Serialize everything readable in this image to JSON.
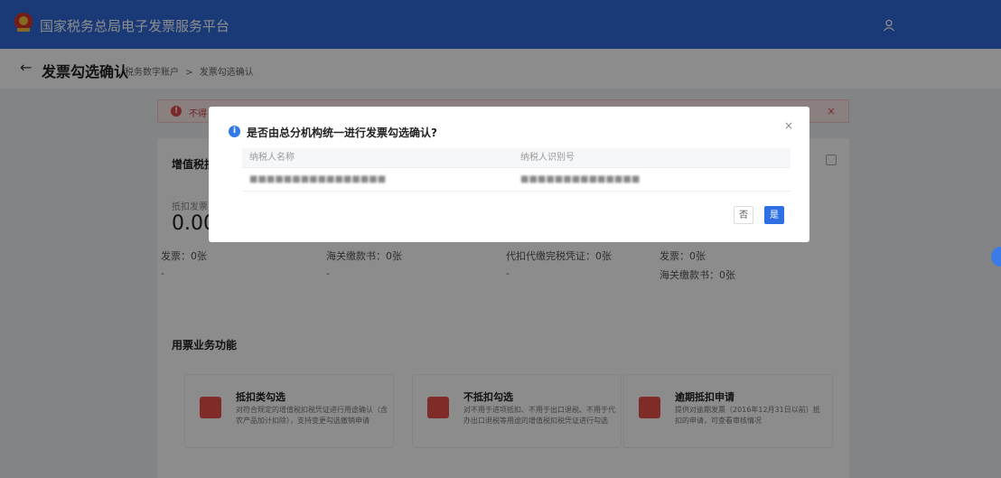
{
  "header": {
    "app_title": "国家税务总局电子发票服务平台"
  },
  "subheader": {
    "back_glyph": "←",
    "page_title": "发票勾选确认",
    "breadcrumb": [
      "税务数字账户",
      ">",
      "发票勾选确认"
    ]
  },
  "alert": {
    "text": "不得",
    "close": "×"
  },
  "stats": {
    "title": "增值税抵",
    "label": "抵扣发票",
    "big_value": "0.00",
    "cols": [
      {
        "line1": "发票：0张",
        "line2": "-"
      },
      {
        "line1": "海关缴款书：0张",
        "line2": "-"
      },
      {
        "line1": "代扣代缴完税凭证：0张",
        "line2": "-"
      },
      {
        "line1": "发票：0张",
        "line2": "海关缴款书：0张"
      }
    ]
  },
  "functions": {
    "title": "用票业务功能",
    "items": [
      {
        "title": "抵扣类勾选",
        "desc": "对符合规定的增值税扣税凭证进行用途确认（含农产品加计扣除），支持变更勾选撤销申请"
      },
      {
        "title": "不抵扣勾选",
        "desc": "对不用于进项抵扣、不用于出口退税、不用于代办出口退税等用途的增值税扣税凭证进行勾选"
      },
      {
        "title": "逾期抵扣申请",
        "desc": "提供对逾期发票（2016年12月31日以前）抵扣的申请，可查看审核情况"
      }
    ]
  },
  "modal": {
    "icon_glyph": "i",
    "title": "是否由总分机构统一进行发票勾选确认?",
    "close": "×",
    "columns": [
      "纳税人名称",
      "纳税人识别号"
    ],
    "rows": [
      {
        "name": "■■■■■■■■■■■■■■■■",
        "tax_id": "■■■■■■■■■■■■■■"
      }
    ],
    "no_label": "否",
    "yes_label": "是"
  },
  "colors": {
    "primary": "#2f6bd8",
    "danger": "#e34a4a"
  }
}
